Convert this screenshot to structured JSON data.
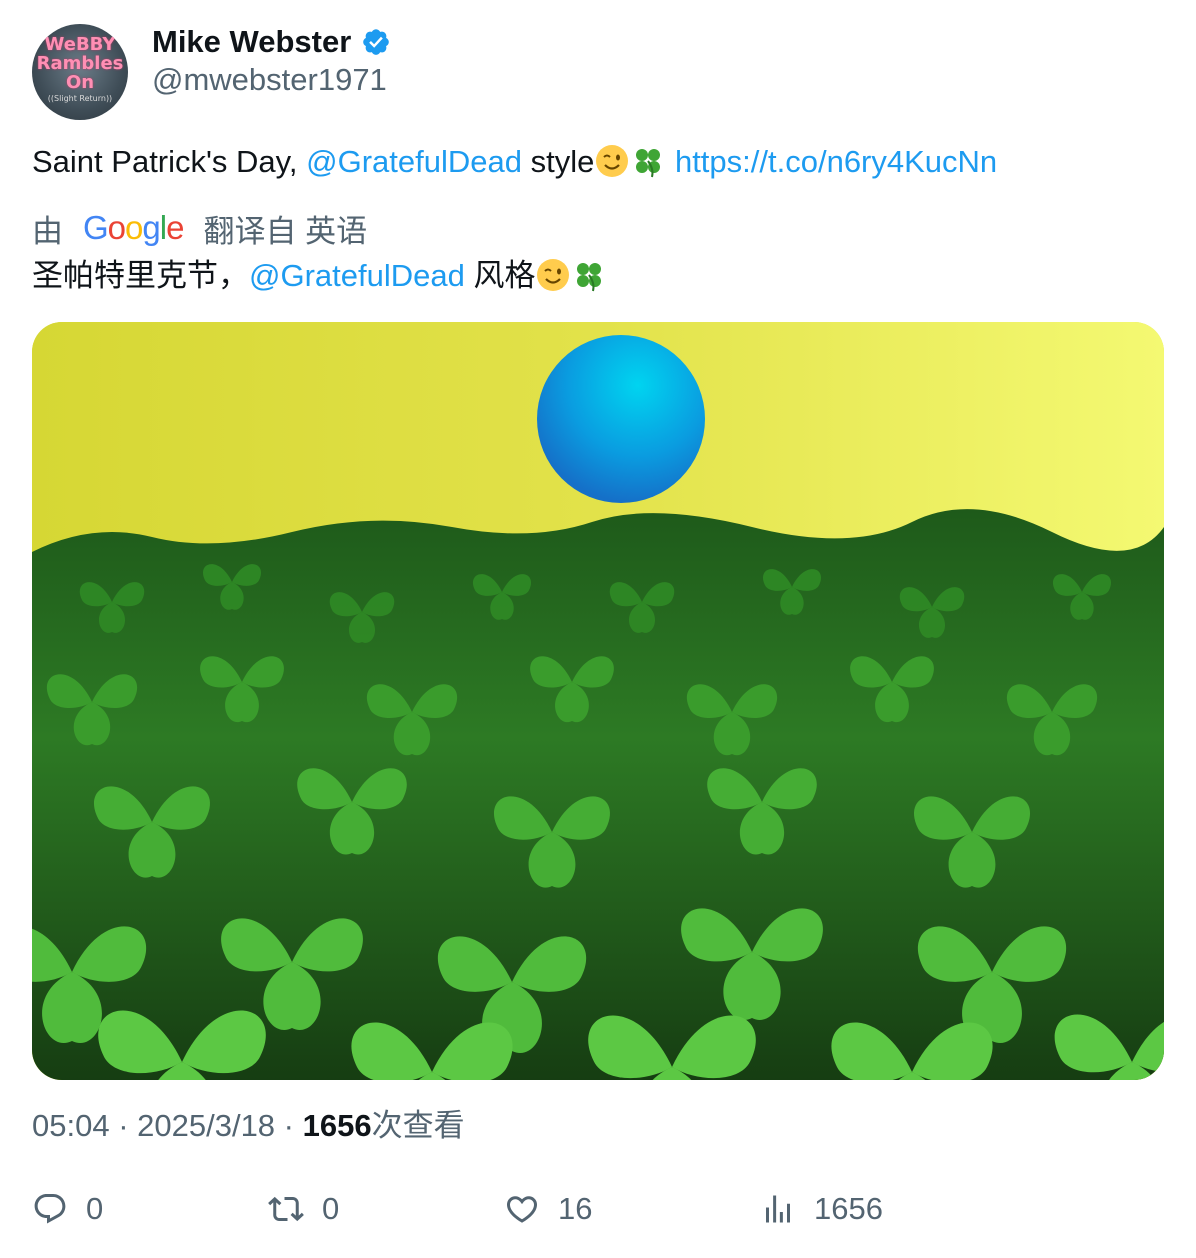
{
  "author": {
    "display_name": "Mike Webster",
    "handle": "@mwebster1971",
    "verified": true,
    "avatar_text": [
      "WeBBY",
      "Rambles",
      "On",
      "((Slight Return))"
    ],
    "avatar_icon": "avatar-image"
  },
  "tweet": {
    "text_prefix": "Saint Patrick's Day, ",
    "mention": "@GratefulDead",
    "text_middle": " style",
    "emojis": [
      "winking-face-emoji",
      "four-leaf-clover-emoji"
    ],
    "link": "https://t.co/n6ry4KucNn"
  },
  "translation": {
    "by_label": "由",
    "provider": "Google",
    "from_label": "翻译自 英语",
    "text_prefix": "圣帕特里克节，",
    "mention": "@GratefulDead",
    "text_suffix": " 风格"
  },
  "media": {
    "image_icon": "clover-field-image"
  },
  "meta": {
    "time": "05:04",
    "separator1": " · ",
    "date": "2025/3/18",
    "separator2": " · ",
    "views": "1656",
    "views_label": "次查看"
  },
  "actions": {
    "replies": "0",
    "retweets": "0",
    "likes": "16",
    "views": "1656"
  },
  "colors": {
    "link": "#1d9bf0",
    "secondary_text": "#536471",
    "primary_text": "#0f1419",
    "verified": "#1d9bf0"
  }
}
